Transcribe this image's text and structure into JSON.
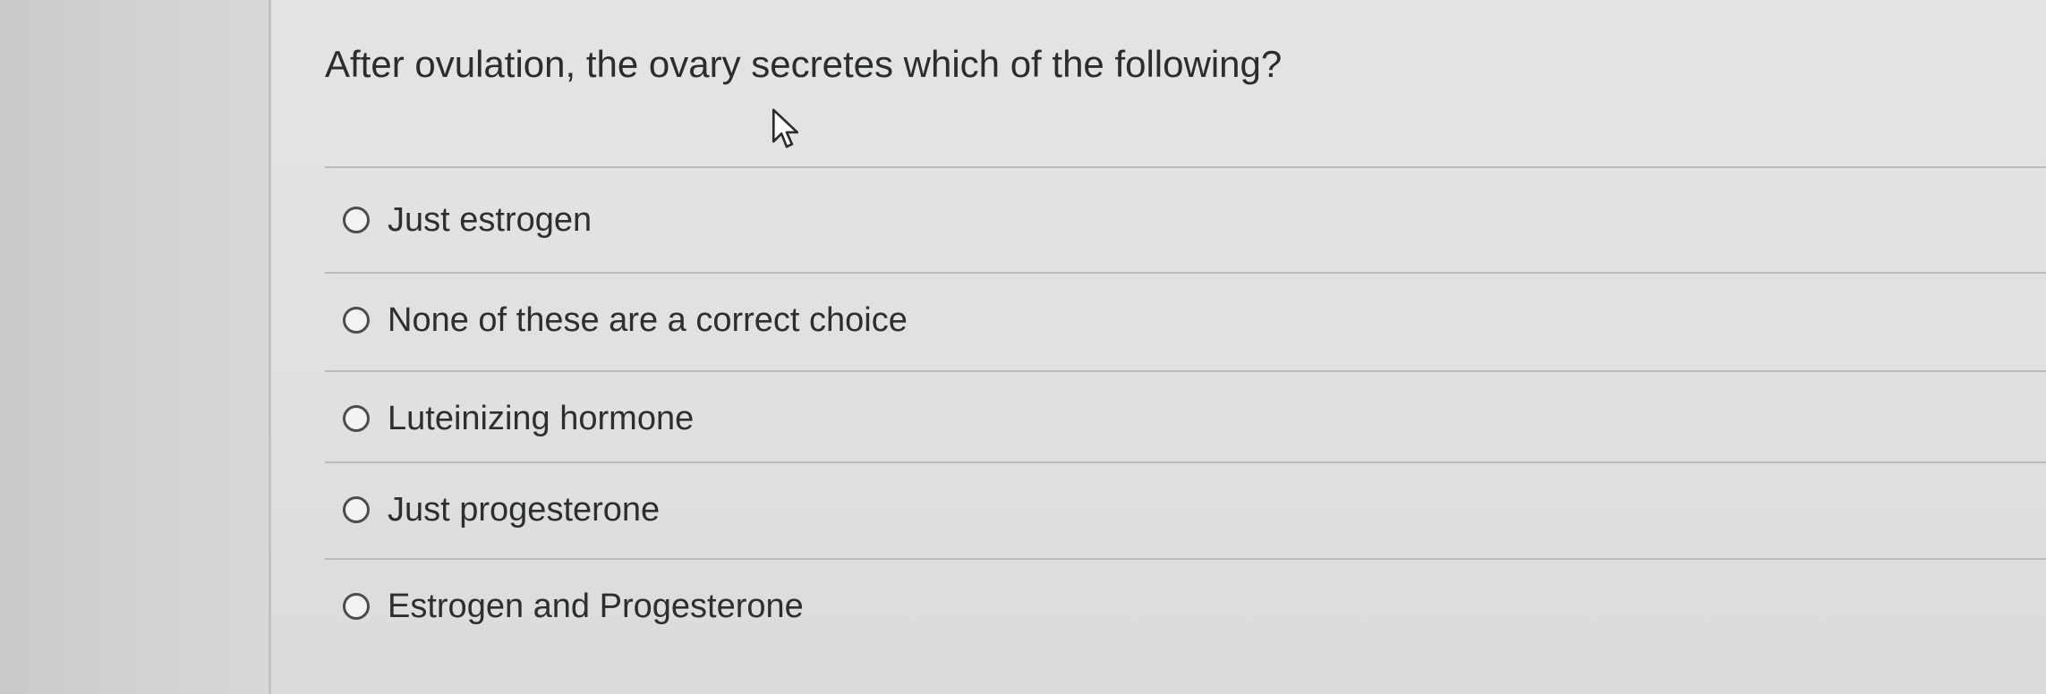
{
  "question": {
    "text": "After ovulation, the ovary secretes which of the following?"
  },
  "options": [
    {
      "label": "Just estrogen",
      "selected": false
    },
    {
      "label": "None of these are a correct choice",
      "selected": false
    },
    {
      "label": "Luteinizing hormone",
      "selected": false
    },
    {
      "label": "Just progesterone",
      "selected": false
    },
    {
      "label": "Estrogen and Progesterone",
      "selected": false
    }
  ],
  "icons": {
    "cursor": "mouse-pointer-icon",
    "radio": "radio-button-icon"
  },
  "colors": {
    "text": "#2a2c2d",
    "background": "#dfe1e0",
    "divider": "#b9bcbb",
    "radio_border": "#4a4c4e"
  }
}
